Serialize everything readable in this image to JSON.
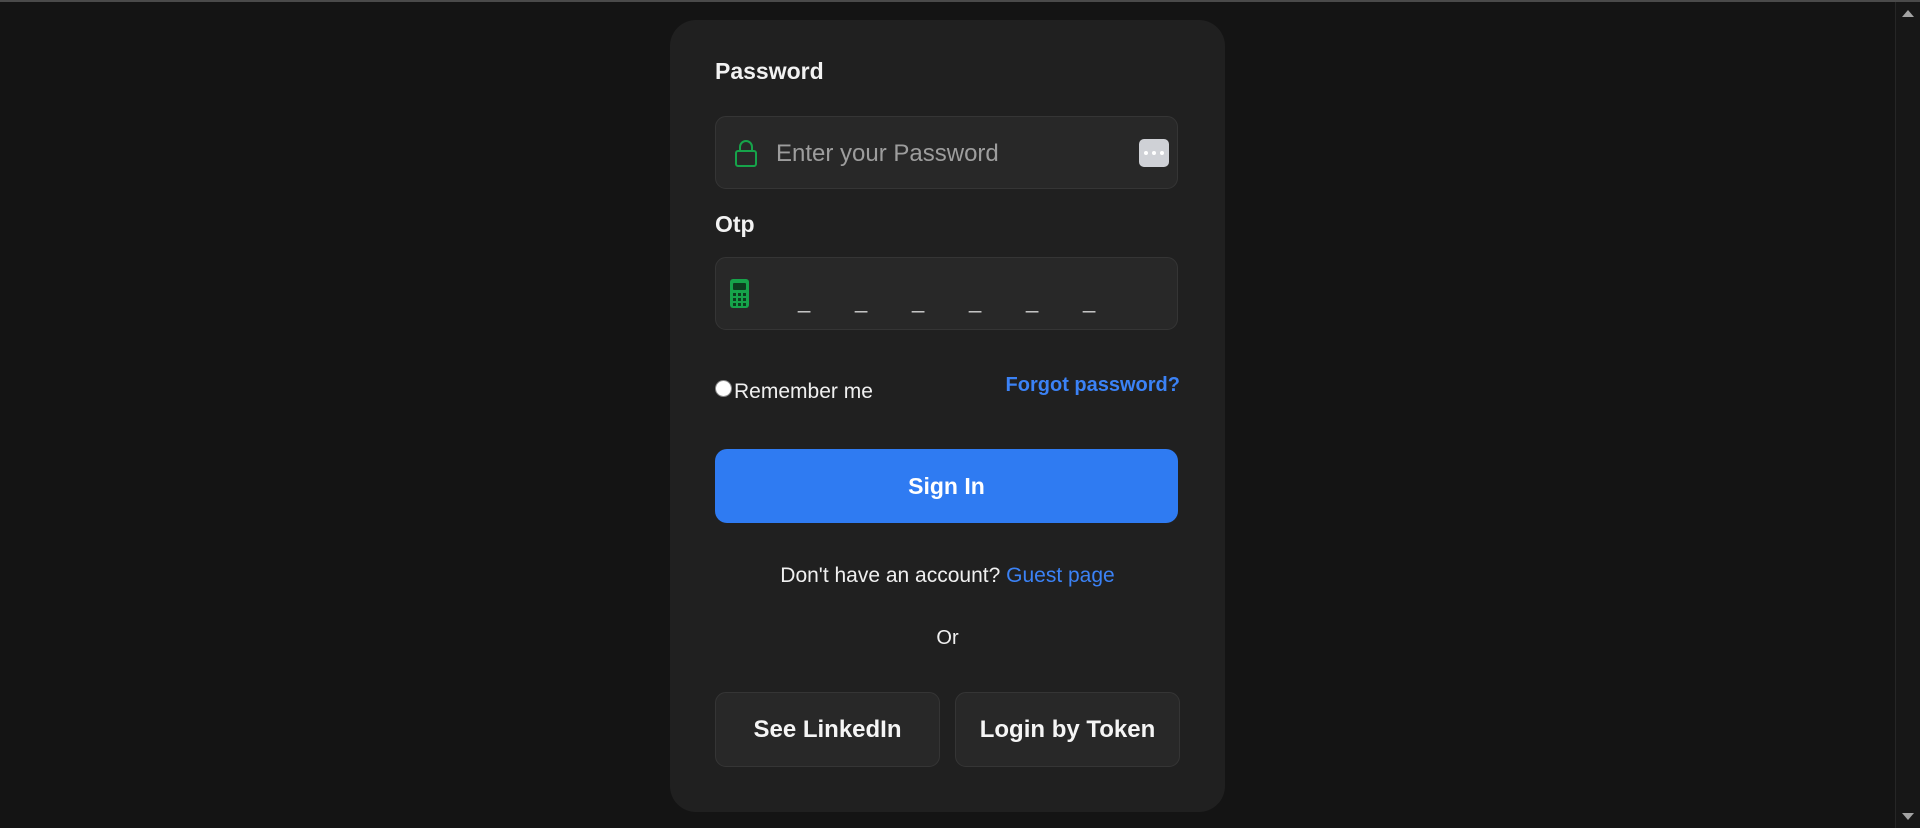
{
  "form": {
    "password_label": "Password",
    "password_placeholder": "Enter your Password",
    "otp_label": "Otp",
    "otp_slots": [
      "_",
      "_",
      "_",
      "_",
      "_",
      "_"
    ],
    "remember_label": "Remember me",
    "forgot_label": "Forgot password?",
    "signin_label": "Sign In",
    "account_prompt": "Don't have an account?",
    "guest_link": "Guest page",
    "or_label": "Or",
    "linkedin_label": "See LinkedIn",
    "token_label": "Login by Token"
  },
  "icons": {
    "password": "lock-icon",
    "reveal": "more-dots-icon",
    "otp": "phone-icon"
  },
  "colors": {
    "accent": "#2f7bf2",
    "link": "#3b82f6",
    "icon_green": "#16a34a",
    "card_bg": "#202020",
    "page_bg": "#141414"
  }
}
